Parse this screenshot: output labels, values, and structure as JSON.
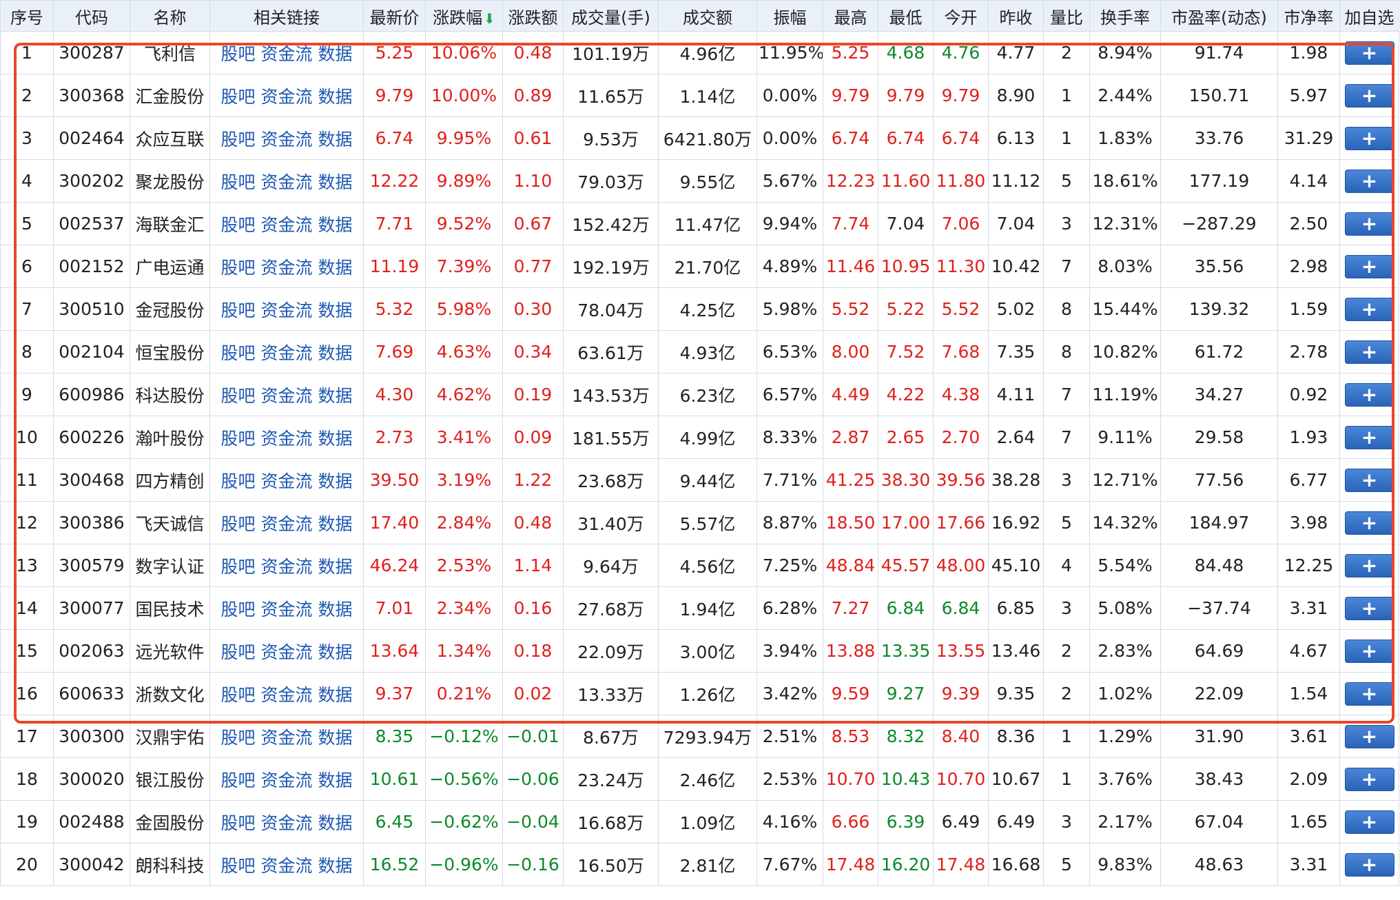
{
  "headers": {
    "seq": "序号",
    "code": "代码",
    "name": "名称",
    "links": "相关链接",
    "price": "最新价",
    "pct": "涨跌幅",
    "chg": "涨跌额",
    "vol": "成交量(手)",
    "amt": "成交额",
    "amp": "振幅",
    "high": "最高",
    "low": "最低",
    "open": "今开",
    "prev": "昨收",
    "vr": "量比",
    "turn": "换手率",
    "pe": "市盈率(动态)",
    "pb": "市净率",
    "add": "加自选"
  },
  "link_labels": [
    "股吧",
    "资金流",
    "数据"
  ],
  "add_label": "+",
  "sort_icon": "down-arrow-icon",
  "colors": {
    "up": "#e0201b",
    "down": "#0a8a2a",
    "link": "#1e58b4",
    "highlight": "#e8472a"
  },
  "rows": [
    {
      "seq": "1",
      "code": "300287",
      "name": "飞利信",
      "price": "5.25",
      "pct": "10.06%",
      "chg": "0.48",
      "vol": "101.19万",
      "amt": "4.96亿",
      "amp": "11.95%",
      "high": "5.25",
      "low": "4.68",
      "open": "4.76",
      "prev": "4.77",
      "vr": "2",
      "turn": "8.94%",
      "pe": "91.74",
      "pb": "1.98",
      "cc": {
        "price": "r",
        "pct": "r",
        "chg": "r",
        "high": "r",
        "low": "g",
        "open": "g"
      }
    },
    {
      "seq": "2",
      "code": "300368",
      "name": "汇金股份",
      "price": "9.79",
      "pct": "10.00%",
      "chg": "0.89",
      "vol": "11.65万",
      "amt": "1.14亿",
      "amp": "0.00%",
      "high": "9.79",
      "low": "9.79",
      "open": "9.79",
      "prev": "8.90",
      "vr": "1",
      "turn": "2.44%",
      "pe": "150.71",
      "pb": "5.97",
      "cc": {
        "price": "r",
        "pct": "r",
        "chg": "r",
        "high": "r",
        "low": "r",
        "open": "r"
      }
    },
    {
      "seq": "3",
      "code": "002464",
      "name": "众应互联",
      "price": "6.74",
      "pct": "9.95%",
      "chg": "0.61",
      "vol": "9.53万",
      "amt": "6421.80万",
      "amp": "0.00%",
      "high": "6.74",
      "low": "6.74",
      "open": "6.74",
      "prev": "6.13",
      "vr": "1",
      "turn": "1.83%",
      "pe": "33.76",
      "pb": "31.29",
      "cc": {
        "price": "r",
        "pct": "r",
        "chg": "r",
        "high": "r",
        "low": "r",
        "open": "r"
      }
    },
    {
      "seq": "4",
      "code": "300202",
      "name": "聚龙股份",
      "price": "12.22",
      "pct": "9.89%",
      "chg": "1.10",
      "vol": "79.03万",
      "amt": "9.55亿",
      "amp": "5.67%",
      "high": "12.23",
      "low": "11.60",
      "open": "11.80",
      "prev": "11.12",
      "vr": "5",
      "turn": "18.61%",
      "pe": "177.19",
      "pb": "4.14",
      "cc": {
        "price": "r",
        "pct": "r",
        "chg": "r",
        "high": "r",
        "low": "r",
        "open": "r"
      }
    },
    {
      "seq": "5",
      "code": "002537",
      "name": "海联金汇",
      "price": "7.71",
      "pct": "9.52%",
      "chg": "0.67",
      "vol": "152.42万",
      "amt": "11.47亿",
      "amp": "9.94%",
      "high": "7.74",
      "low": "7.04",
      "open": "7.06",
      "prev": "7.04",
      "vr": "3",
      "turn": "12.31%",
      "pe": "-287.29",
      "pb": "2.50",
      "cc": {
        "price": "r",
        "pct": "r",
        "chg": "r",
        "high": "r",
        "low": "",
        "open": "r"
      }
    },
    {
      "seq": "6",
      "code": "002152",
      "name": "广电运通",
      "price": "11.19",
      "pct": "7.39%",
      "chg": "0.77",
      "vol": "192.19万",
      "amt": "21.70亿",
      "amp": "4.89%",
      "high": "11.46",
      "low": "10.95",
      "open": "11.30",
      "prev": "10.42",
      "vr": "7",
      "turn": "8.03%",
      "pe": "35.56",
      "pb": "2.98",
      "cc": {
        "price": "r",
        "pct": "r",
        "chg": "r",
        "high": "r",
        "low": "r",
        "open": "r"
      }
    },
    {
      "seq": "7",
      "code": "300510",
      "name": "金冠股份",
      "price": "5.32",
      "pct": "5.98%",
      "chg": "0.30",
      "vol": "78.04万",
      "amt": "4.25亿",
      "amp": "5.98%",
      "high": "5.52",
      "low": "5.22",
      "open": "5.52",
      "prev": "5.02",
      "vr": "8",
      "turn": "15.44%",
      "pe": "139.32",
      "pb": "1.59",
      "cc": {
        "price": "r",
        "pct": "r",
        "chg": "r",
        "high": "r",
        "low": "r",
        "open": "r"
      }
    },
    {
      "seq": "8",
      "code": "002104",
      "name": "恒宝股份",
      "price": "7.69",
      "pct": "4.63%",
      "chg": "0.34",
      "vol": "63.61万",
      "amt": "4.93亿",
      "amp": "6.53%",
      "high": "8.00",
      "low": "7.52",
      "open": "7.68",
      "prev": "7.35",
      "vr": "8",
      "turn": "10.82%",
      "pe": "61.72",
      "pb": "2.78",
      "cc": {
        "price": "r",
        "pct": "r",
        "chg": "r",
        "high": "r",
        "low": "r",
        "open": "r"
      }
    },
    {
      "seq": "9",
      "code": "600986",
      "name": "科达股份",
      "price": "4.30",
      "pct": "4.62%",
      "chg": "0.19",
      "vol": "143.53万",
      "amt": "6.23亿",
      "amp": "6.57%",
      "high": "4.49",
      "low": "4.22",
      "open": "4.38",
      "prev": "4.11",
      "vr": "7",
      "turn": "11.19%",
      "pe": "34.27",
      "pb": "0.92",
      "cc": {
        "price": "r",
        "pct": "r",
        "chg": "r",
        "high": "r",
        "low": "r",
        "open": "r"
      }
    },
    {
      "seq": "10",
      "code": "600226",
      "name": "瀚叶股份",
      "price": "2.73",
      "pct": "3.41%",
      "chg": "0.09",
      "vol": "181.55万",
      "amt": "4.99亿",
      "amp": "8.33%",
      "high": "2.87",
      "low": "2.65",
      "open": "2.70",
      "prev": "2.64",
      "vr": "7",
      "turn": "9.11%",
      "pe": "29.58",
      "pb": "1.93",
      "cc": {
        "price": "r",
        "pct": "r",
        "chg": "r",
        "high": "r",
        "low": "r",
        "open": "r"
      }
    },
    {
      "seq": "11",
      "code": "300468",
      "name": "四方精创",
      "price": "39.50",
      "pct": "3.19%",
      "chg": "1.22",
      "vol": "23.68万",
      "amt": "9.44亿",
      "amp": "7.71%",
      "high": "41.25",
      "low": "38.30",
      "open": "39.56",
      "prev": "38.28",
      "vr": "3",
      "turn": "12.71%",
      "pe": "77.56",
      "pb": "6.77",
      "cc": {
        "price": "r",
        "pct": "r",
        "chg": "r",
        "high": "r",
        "low": "r",
        "open": "r"
      }
    },
    {
      "seq": "12",
      "code": "300386",
      "name": "飞天诚信",
      "price": "17.40",
      "pct": "2.84%",
      "chg": "0.48",
      "vol": "31.40万",
      "amt": "5.57亿",
      "amp": "8.87%",
      "high": "18.50",
      "low": "17.00",
      "open": "17.66",
      "prev": "16.92",
      "vr": "5",
      "turn": "14.32%",
      "pe": "184.97",
      "pb": "3.98",
      "cc": {
        "price": "r",
        "pct": "r",
        "chg": "r",
        "high": "r",
        "low": "r",
        "open": "r"
      }
    },
    {
      "seq": "13",
      "code": "300579",
      "name": "数字认证",
      "price": "46.24",
      "pct": "2.53%",
      "chg": "1.14",
      "vol": "9.64万",
      "amt": "4.56亿",
      "amp": "7.25%",
      "high": "48.84",
      "low": "45.57",
      "open": "48.00",
      "prev": "45.10",
      "vr": "4",
      "turn": "5.54%",
      "pe": "84.48",
      "pb": "12.25",
      "cc": {
        "price": "r",
        "pct": "r",
        "chg": "r",
        "high": "r",
        "low": "r",
        "open": "r"
      }
    },
    {
      "seq": "14",
      "code": "300077",
      "name": "国民技术",
      "price": "7.01",
      "pct": "2.34%",
      "chg": "0.16",
      "vol": "27.68万",
      "amt": "1.94亿",
      "amp": "6.28%",
      "high": "7.27",
      "low": "6.84",
      "open": "6.84",
      "prev": "6.85",
      "vr": "3",
      "turn": "5.08%",
      "pe": "-37.74",
      "pb": "3.31",
      "cc": {
        "price": "r",
        "pct": "r",
        "chg": "r",
        "high": "r",
        "low": "g",
        "open": "g"
      }
    },
    {
      "seq": "15",
      "code": "002063",
      "name": "远光软件",
      "price": "13.64",
      "pct": "1.34%",
      "chg": "0.18",
      "vol": "22.09万",
      "amt": "3.00亿",
      "amp": "3.94%",
      "high": "13.88",
      "low": "13.35",
      "open": "13.55",
      "prev": "13.46",
      "vr": "2",
      "turn": "2.83%",
      "pe": "64.69",
      "pb": "4.67",
      "cc": {
        "price": "r",
        "pct": "r",
        "chg": "r",
        "high": "r",
        "low": "g",
        "open": "r"
      }
    },
    {
      "seq": "16",
      "code": "600633",
      "name": "浙数文化",
      "price": "9.37",
      "pct": "0.21%",
      "chg": "0.02",
      "vol": "13.33万",
      "amt": "1.26亿",
      "amp": "3.42%",
      "high": "9.59",
      "low": "9.27",
      "open": "9.39",
      "prev": "9.35",
      "vr": "2",
      "turn": "1.02%",
      "pe": "22.09",
      "pb": "1.54",
      "cc": {
        "price": "r",
        "pct": "r",
        "chg": "r",
        "high": "r",
        "low": "g",
        "open": "r"
      }
    },
    {
      "seq": "17",
      "code": "300300",
      "name": "汉鼎宇佑",
      "price": "8.35",
      "pct": "-0.12%",
      "chg": "-0.01",
      "vol": "8.67万",
      "amt": "7293.94万",
      "amp": "2.51%",
      "high": "8.53",
      "low": "8.32",
      "open": "8.40",
      "prev": "8.36",
      "vr": "1",
      "turn": "1.29%",
      "pe": "31.90",
      "pb": "3.61",
      "cc": {
        "price": "g",
        "pct": "g",
        "chg": "g",
        "high": "r",
        "low": "g",
        "open": "r"
      }
    },
    {
      "seq": "18",
      "code": "300020",
      "name": "银江股份",
      "price": "10.61",
      "pct": "-0.56%",
      "chg": "-0.06",
      "vol": "23.24万",
      "amt": "2.46亿",
      "amp": "2.53%",
      "high": "10.70",
      "low": "10.43",
      "open": "10.70",
      "prev": "10.67",
      "vr": "1",
      "turn": "3.76%",
      "pe": "38.43",
      "pb": "2.09",
      "cc": {
        "price": "g",
        "pct": "g",
        "chg": "g",
        "high": "r",
        "low": "g",
        "open": "r"
      }
    },
    {
      "seq": "19",
      "code": "002488",
      "name": "金固股份",
      "price": "6.45",
      "pct": "-0.62%",
      "chg": "-0.04",
      "vol": "16.68万",
      "amt": "1.09亿",
      "amp": "4.16%",
      "high": "6.66",
      "low": "6.39",
      "open": "6.49",
      "prev": "6.49",
      "vr": "3",
      "turn": "2.17%",
      "pe": "67.04",
      "pb": "1.65",
      "cc": {
        "price": "g",
        "pct": "g",
        "chg": "g",
        "high": "r",
        "low": "g",
        "open": ""
      }
    },
    {
      "seq": "20",
      "code": "300042",
      "name": "朗科科技",
      "price": "16.52",
      "pct": "-0.96%",
      "chg": "-0.16",
      "vol": "16.50万",
      "amt": "2.81亿",
      "amp": "7.67%",
      "high": "17.48",
      "low": "16.20",
      "open": "17.48",
      "prev": "16.68",
      "vr": "5",
      "turn": "9.83%",
      "pe": "48.63",
      "pb": "3.31",
      "cc": {
        "price": "g",
        "pct": "g",
        "chg": "g",
        "high": "r",
        "low": "g",
        "open": "r"
      }
    }
  ]
}
